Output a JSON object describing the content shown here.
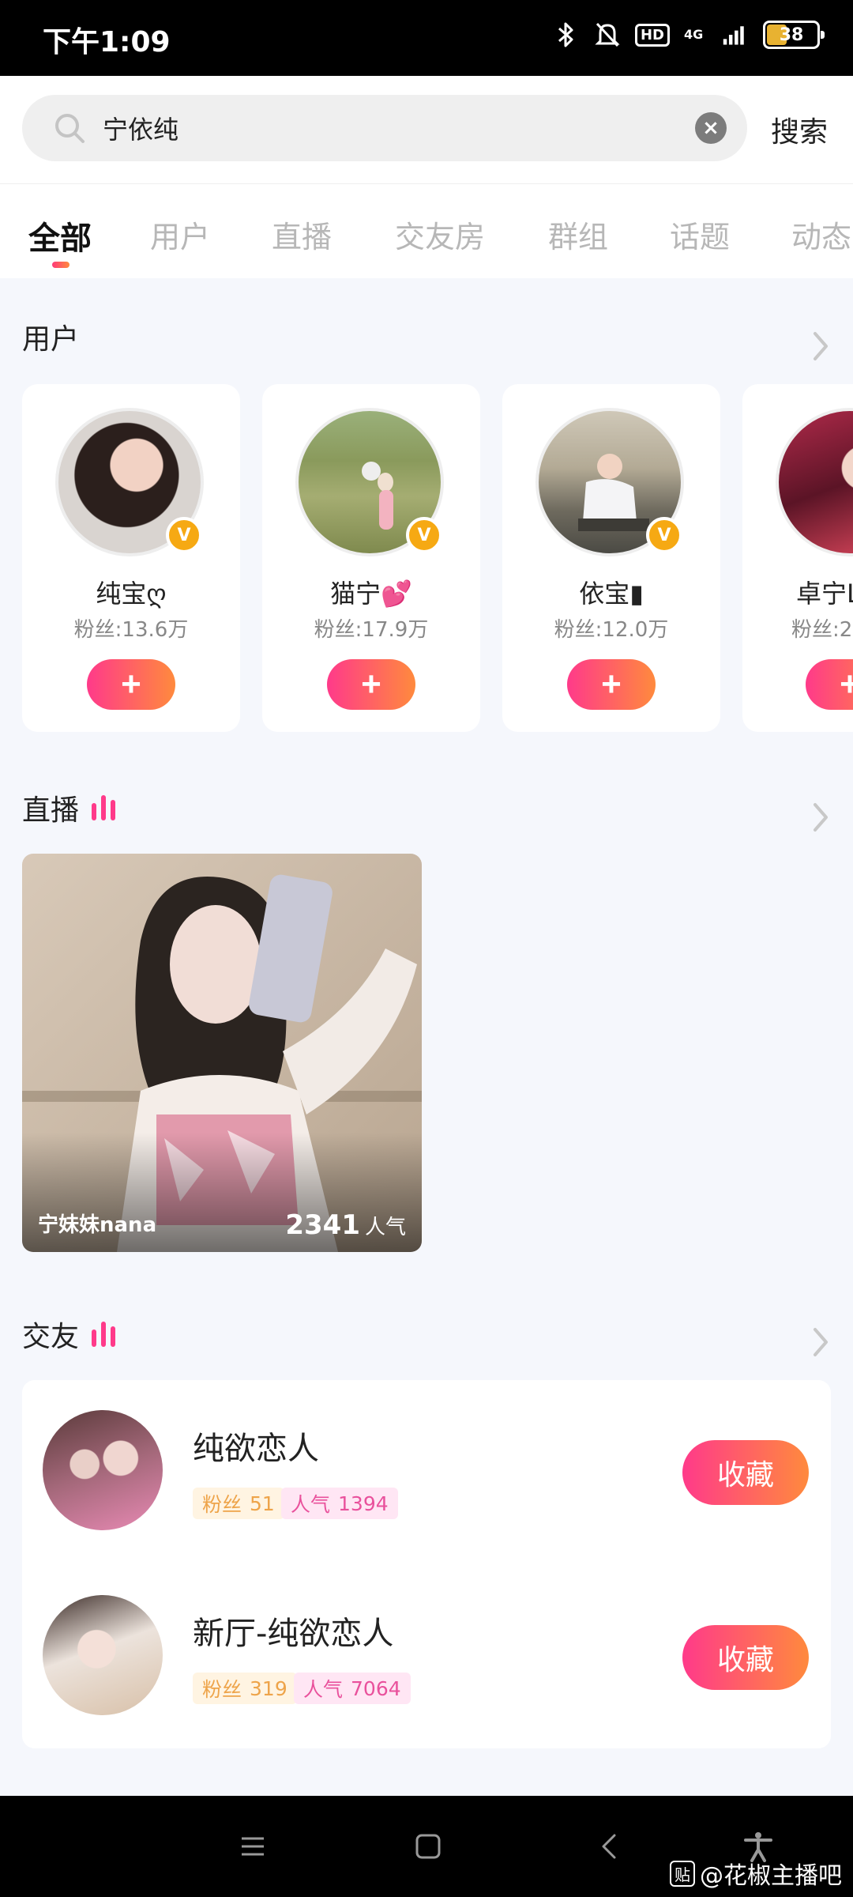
{
  "status_bar": {
    "time": "下午1:09",
    "battery": "38",
    "network": "4G",
    "hd": "HD"
  },
  "search": {
    "value": "宁依纯",
    "placeholder": "",
    "button_label": "搜索"
  },
  "tabs": [
    "全部",
    "用户",
    "直播",
    "交友房",
    "群组",
    "话题",
    "动态"
  ],
  "active_tab": "全部",
  "users_section": {
    "title": "用户",
    "users": [
      {
        "name": "纯宝ღ",
        "fans": "粉丝:13.6万",
        "verified": "V",
        "follow": "+"
      },
      {
        "name": "猫宁💕",
        "fans": "粉丝:17.9万",
        "verified": "V",
        "follow": "+"
      },
      {
        "name": "依宝▮",
        "fans": "粉丝:12.0万",
        "verified": "V",
        "follow": "+"
      },
      {
        "name": "卓宁L",
        "fans": "粉丝:2",
        "verified": "",
        "follow": "+"
      }
    ]
  },
  "live_section": {
    "title": "直播",
    "live": {
      "streamer": "宁妹妹nana",
      "popularity_value": "2341",
      "popularity_label": "人气"
    }
  },
  "friend_section": {
    "title": "交友",
    "rooms": [
      {
        "title": "纯欲恋人",
        "fans_label": "粉丝",
        "fans_value": "51",
        "pop_label": "人气",
        "pop_value": "1394",
        "collect_label": "收藏"
      },
      {
        "title": "新厅-纯欲恋人",
        "fans_label": "粉丝",
        "fans_value": "319",
        "pop_label": "人气",
        "pop_value": "7064",
        "collect_label": "收藏"
      }
    ]
  },
  "watermark": {
    "icon_text": "贴",
    "text": "@花椒主播吧"
  },
  "colors": {
    "accent_start": "#ff3a8a",
    "accent_end": "#ff8a3d",
    "page_bg": "#f5f7fc"
  }
}
